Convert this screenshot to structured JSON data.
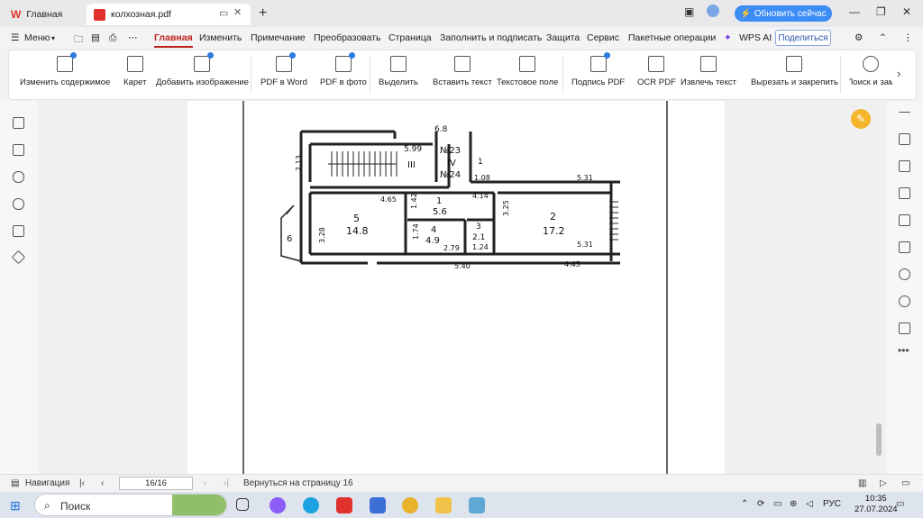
{
  "titlebar": {
    "tab_home": "Главная",
    "tab_doc": "колхозная.pdf",
    "update_button": "Обновить сейчас"
  },
  "menubar": {
    "menu": "Меню",
    "items": [
      "Главная",
      "Изменить",
      "Примечание",
      "Преобразовать",
      "Страница",
      "Заполнить и подписать",
      "Защита",
      "Сервис",
      "Пакетные операции"
    ],
    "wps_ai": "WPS AI",
    "share": "Поделиться"
  },
  "ribbon": {
    "buttons": [
      "Изменить содержимое",
      "Карет",
      "Добавить изображение",
      "PDF в Word",
      "PDF в фото",
      "Выделить",
      "Вставить текст",
      "Текстовое поле",
      "Подпись PDF",
      "OCR PDF",
      "Извлечь текст",
      "Вырезать и закрепить",
      "Поиск и зам"
    ]
  },
  "floorplan": {
    "labels": [
      "6.8",
      "5.99",
      "№23",
      "IV",
      "№24",
      "III",
      "2.13",
      "1",
      "1.08",
      "5.31",
      "4.65",
      "1.42",
      "1",
      "5.6",
      "4.14",
      "3.25",
      "5",
      "14.8",
      "2",
      "17.2",
      "6",
      "3.28",
      "1.74",
      "4",
      "4.9",
      "2.79",
      "3",
      "2.1",
      "1.24",
      "5.31",
      "5.40",
      "4.45"
    ]
  },
  "statusbar": {
    "navigation": "Навигация",
    "page": "16/16",
    "back": "Вернуться на страницу 16"
  },
  "taskbar": {
    "search": "Поиск",
    "lang": "РУС",
    "time": "10:35",
    "date": "27.07.2024"
  },
  "colors": {
    "accent": "#c0201c",
    "update": "#3b8cf5",
    "fab": "#f3b52b"
  }
}
